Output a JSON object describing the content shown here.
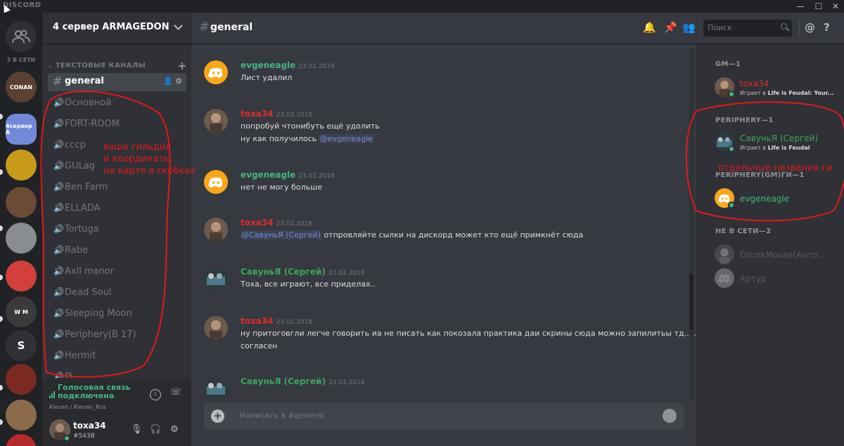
{
  "app": {
    "brand": "DISCORD"
  },
  "window_controls": {
    "minimize": "—",
    "maximize": "☐",
    "close": "✕"
  },
  "servers": {
    "online_count": "3 В СЕТИ",
    "items": [
      {
        "label": "CONAN",
        "color": "#5a4030"
      },
      {
        "label": "4сервер A",
        "color": "#7289da"
      },
      {
        "label": "",
        "color": "#c89b1a"
      },
      {
        "label": "",
        "color": "#6b4a36"
      },
      {
        "label": "",
        "color": "#8a8d90"
      },
      {
        "label": "",
        "color": "#d3403b"
      },
      {
        "label": "W M",
        "color": "#3a3a3a"
      },
      {
        "label": "S",
        "color": "#2f3136"
      },
      {
        "label": "",
        "color": "#7a2a20"
      },
      {
        "label": "",
        "color": "#8c6b4a"
      },
      {
        "label": "",
        "color": "#b52a2a"
      }
    ]
  },
  "guild": {
    "name": "4 сервер ARMAGEDON",
    "category": "ТЕКСТОВЫЕ КАНАЛЫ",
    "active_channel": "general",
    "voice_channels": [
      "Основной",
      "FORT-ROOM",
      "cccp",
      "GULag",
      "Ben Farm",
      "ELLADA",
      "Tortuga",
      "Rabe",
      "Axll manor",
      "Dead Soul",
      "Sleeping Moon",
      "Periphery(В 17)",
      "Hermit",
      "Pi"
    ]
  },
  "voice_panel": {
    "status_line1": "Голосовая связь",
    "status_line2": "подключена",
    "location": "Kievan / Kievan_Rus"
  },
  "user": {
    "name": "toxa34",
    "tag": "#5438"
  },
  "chat": {
    "channel": "general",
    "search_placeholder": "Поиск",
    "composer_placeholder": "Написать в #general",
    "messages": [
      {
        "author": "evgeneagle",
        "color": "#43b581",
        "time": "23.02.2018",
        "lines": [
          "Лист удалил"
        ]
      },
      {
        "author": "toxa34",
        "color": "#e02b2b",
        "time": "23.02.2018",
        "lines": [
          "попробуй чтонибуть ещё удолить",
          "ну как получилось"
        ],
        "mention": "@evgeneagle"
      },
      {
        "author": "evgeneagle",
        "color": "#43b581",
        "time": "23.02.2018",
        "lines": [
          "нет не могу больше"
        ]
      },
      {
        "author": "toxa34",
        "color": "#e02b2b",
        "time": "23.02.2018",
        "mention": "@СавуньЯ (Сергей)",
        "lines": [
          "отпровляйте сылки на дискорд может кто ещё примкнёт сюда"
        ]
      },
      {
        "author": "СавуньЯ (Сергей)",
        "color": "#3ba55c",
        "time": "23.02.2018",
        "lines": [
          "Тоха, все играют, все приделах.."
        ]
      },
      {
        "author": "toxa34",
        "color": "#e02b2b",
        "time": "23.02.2018",
        "lines": [
          "ну притоговгли легче говорить иа не писать как покозала практика даи скрины сюда можно запилитьы тд.....",
          "согласен"
        ]
      },
      {
        "author": "СавуньЯ (Сергей)",
        "color": "#3ba55c",
        "time": "23.02.2018",
        "lines": []
      }
    ]
  },
  "members": {
    "groups": [
      {
        "title": "GM—1",
        "members": [
          {
            "name": "toxa34",
            "color": "#e02b2b",
            "game_prefix": "Играет в ",
            "game": "Life is Feudal: Your...",
            "status": "online"
          }
        ]
      },
      {
        "title": "PERIPHERY—1",
        "members": [
          {
            "name": "СавуньЯ (Сергей)",
            "color": "#3ba55c",
            "game_prefix": "Играет в ",
            "game": "Life is Feudal",
            "status": "online"
          }
        ]
      },
      {
        "title": "PERIPHERY(GM)ГИ—1",
        "members": [
          {
            "name": "evgeneagle",
            "color": "#43b581",
            "game_prefix": "",
            "game": "",
            "status": "online"
          }
        ]
      },
      {
        "title": "НЕ В СЕТИ—2",
        "members": [
          {
            "name": "DrunkMouse(Анто...",
            "color": "#8e9297",
            "status": "offline"
          },
          {
            "name": "Артур",
            "color": "#8e9297",
            "status": "offline"
          }
        ]
      }
    ]
  },
  "annotations": {
    "left_note": [
      "ваша гильдия",
      "и координаты",
      "на карте в скобках"
    ],
    "right_note": "отдельные названия ги",
    "color": "#e31818"
  }
}
